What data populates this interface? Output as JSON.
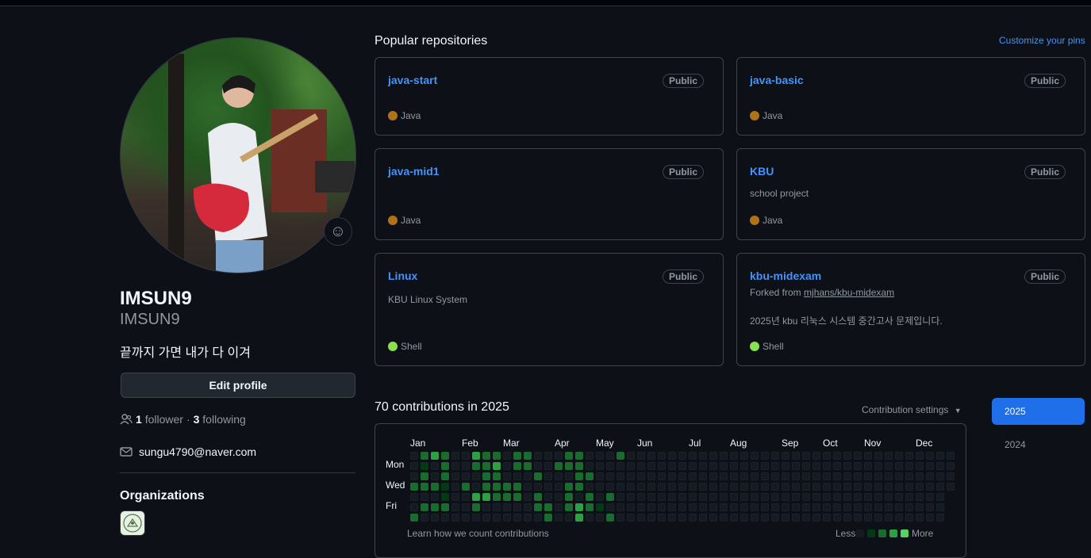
{
  "profile": {
    "name": "IMSUN9",
    "login": "IMSUN9",
    "bio": "끝까지 가면 내가 다 이겨",
    "edit_label": "Edit profile",
    "followers_count": "1",
    "followers_label": "follower",
    "separator": "·",
    "following_count": "3",
    "following_label": "following",
    "email": "sungu4790@naver.com",
    "orgs_title": "Organizations"
  },
  "pinned": {
    "title": "Popular repositories",
    "customize_label": "Customize your pins",
    "repos": [
      {
        "name": "java-start",
        "visibility": "Public",
        "description": "",
        "language": "Java",
        "lang_color": "#b07219"
      },
      {
        "name": "java-basic",
        "visibility": "Public",
        "description": "",
        "language": "Java",
        "lang_color": "#b07219"
      },
      {
        "name": "java-mid1",
        "visibility": "Public",
        "description": "",
        "language": "Java",
        "lang_color": "#b07219"
      },
      {
        "name": "KBU",
        "visibility": "Public",
        "description": "school project",
        "language": "Java",
        "lang_color": "#b07219"
      },
      {
        "name": "Linux",
        "visibility": "Public",
        "description": "KBU Linux System",
        "language": "Shell",
        "lang_color": "#89e051"
      },
      {
        "name": "kbu-midexam",
        "visibility": "Public",
        "forked_prefix": "Forked from",
        "forked_from": "mjhans/kbu-midexam",
        "description": "2025년 kbu 리눅스 시스템 중간고사 문제입니다.",
        "language": "Shell",
        "lang_color": "#89e051"
      }
    ]
  },
  "contributions": {
    "title": "70 contributions in 2025",
    "settings_label": "Contribution settings",
    "months": [
      "Jan",
      "Feb",
      "Mar",
      "Apr",
      "May",
      "Jun",
      "Jul",
      "Aug",
      "Sep",
      "Oct",
      "Nov",
      "Dec"
    ],
    "day_labels": [
      "Mon",
      "Wed",
      "Fri"
    ],
    "learn_label": "Learn how we count contributions",
    "less_label": "Less",
    "more_label": "More",
    "level_colors": [
      "#151b23",
      "#033a16",
      "#196c2e",
      "#2ea043",
      "#56d364"
    ]
  },
  "years": {
    "active": "2025",
    "other": "2024"
  }
}
